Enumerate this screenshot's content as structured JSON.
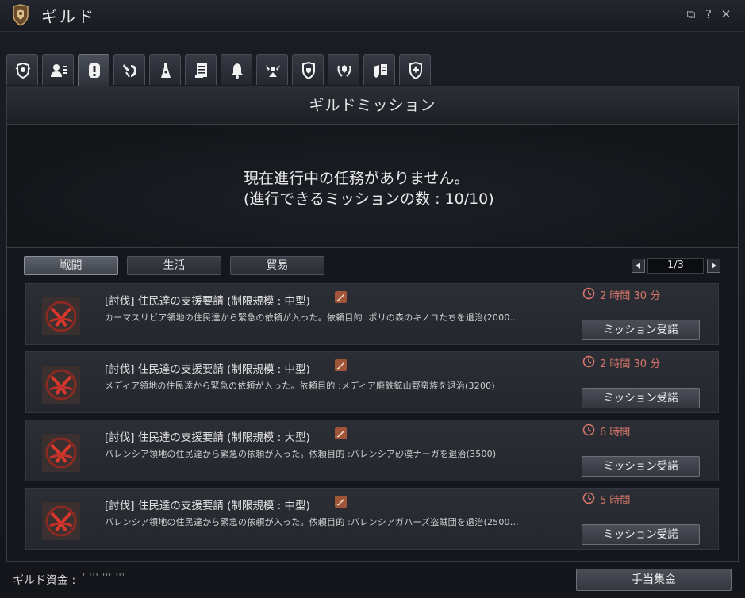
{
  "window": {
    "title": "ギルド",
    "controls": {
      "restore_icon": "⧉",
      "help_icon": "?",
      "close_icon": "✕"
    }
  },
  "tabs": [
    {
      "icon": "guild-crest-icon",
      "active": false
    },
    {
      "icon": "members-icon",
      "active": false
    },
    {
      "icon": "mission-alert-icon",
      "active": true
    },
    {
      "icon": "skills-icon",
      "active": false
    },
    {
      "icon": "rank-dress-icon",
      "active": false
    },
    {
      "icon": "notice-board-icon",
      "active": false
    },
    {
      "icon": "bell-icon",
      "active": false
    },
    {
      "icon": "war-declaration-icon",
      "active": false
    },
    {
      "icon": "guild-shield-icon",
      "active": false
    },
    {
      "icon": "laurel-icon",
      "active": false
    },
    {
      "icon": "contract-shield-icon",
      "active": false
    },
    {
      "icon": "fleur-icon",
      "active": false
    }
  ],
  "panel": {
    "title": "ギルドミッション",
    "status_line1": "現在進行中の任務がありません。",
    "status_line2": "(進行できるミッションの数 : 10/10)"
  },
  "categories": [
    {
      "label": "戦闘",
      "active": true
    },
    {
      "label": "生活",
      "active": false
    },
    {
      "label": "貿易",
      "active": false
    }
  ],
  "pager": {
    "page": "1/3"
  },
  "missions": [
    {
      "title": "[討伐] 住民達の支援要請 (制限規模 : 中型)",
      "description": "カーマスリビア領地の住民達から緊急の依頼が入った。依頼目的 :ポリの森のキノコたちを退治(2000...",
      "time": "2 時間 30 分",
      "button": "ミッション受諾"
    },
    {
      "title": "[討伐] 住民達の支援要請 (制限規模 : 中型)",
      "description": "メディア領地の住民達から緊急の依頼が入った。依頼目的 :メディア廃鉄鉱山野蛮族を退治(3200)",
      "time": "2 時間 30 分",
      "button": "ミッション受諾"
    },
    {
      "title": "[討伐] 住民達の支援要請 (制限規模 : 大型)",
      "description": "バレンシア領地の住民達から緊急の依頼が入った。依頼目的 :バレンシア砂漠ナーガを退治(3500)",
      "time": "6 時間",
      "button": "ミッション受諾"
    },
    {
      "title": "[討伐] 住民達の支援要請 (制限規模 : 中型)",
      "description": "バレンシア領地の住民達から緊急の依頼が入った。依頼目的 :バレンシアガハーズ盗賊団を退治(2500...",
      "time": "5 時間",
      "button": "ミッション受諾"
    }
  ],
  "footer": {
    "funds_label": "ギルド資金 :",
    "funds_value": "' ''' ''' '''",
    "collect_button": "手当集金"
  },
  "colors": {
    "time_text": "#d9766b",
    "badge": "#a05438",
    "mission_icon_red": "#c0322a"
  }
}
